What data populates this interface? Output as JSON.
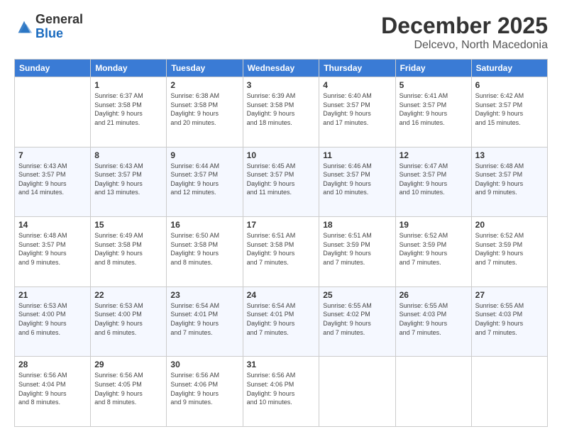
{
  "logo": {
    "general": "General",
    "blue": "Blue"
  },
  "header": {
    "month": "December 2025",
    "location": "Delcevo, North Macedonia"
  },
  "weekdays": [
    "Sunday",
    "Monday",
    "Tuesday",
    "Wednesday",
    "Thursday",
    "Friday",
    "Saturday"
  ],
  "weeks": [
    [
      {
        "day": "",
        "info": ""
      },
      {
        "day": "1",
        "info": "Sunrise: 6:37 AM\nSunset: 3:58 PM\nDaylight: 9 hours\nand 21 minutes."
      },
      {
        "day": "2",
        "info": "Sunrise: 6:38 AM\nSunset: 3:58 PM\nDaylight: 9 hours\nand 20 minutes."
      },
      {
        "day": "3",
        "info": "Sunrise: 6:39 AM\nSunset: 3:58 PM\nDaylight: 9 hours\nand 18 minutes."
      },
      {
        "day": "4",
        "info": "Sunrise: 6:40 AM\nSunset: 3:57 PM\nDaylight: 9 hours\nand 17 minutes."
      },
      {
        "day": "5",
        "info": "Sunrise: 6:41 AM\nSunset: 3:57 PM\nDaylight: 9 hours\nand 16 minutes."
      },
      {
        "day": "6",
        "info": "Sunrise: 6:42 AM\nSunset: 3:57 PM\nDaylight: 9 hours\nand 15 minutes."
      }
    ],
    [
      {
        "day": "7",
        "info": "Sunrise: 6:43 AM\nSunset: 3:57 PM\nDaylight: 9 hours\nand 14 minutes."
      },
      {
        "day": "8",
        "info": "Sunrise: 6:43 AM\nSunset: 3:57 PM\nDaylight: 9 hours\nand 13 minutes."
      },
      {
        "day": "9",
        "info": "Sunrise: 6:44 AM\nSunset: 3:57 PM\nDaylight: 9 hours\nand 12 minutes."
      },
      {
        "day": "10",
        "info": "Sunrise: 6:45 AM\nSunset: 3:57 PM\nDaylight: 9 hours\nand 11 minutes."
      },
      {
        "day": "11",
        "info": "Sunrise: 6:46 AM\nSunset: 3:57 PM\nDaylight: 9 hours\nand 10 minutes."
      },
      {
        "day": "12",
        "info": "Sunrise: 6:47 AM\nSunset: 3:57 PM\nDaylight: 9 hours\nand 10 minutes."
      },
      {
        "day": "13",
        "info": "Sunrise: 6:48 AM\nSunset: 3:57 PM\nDaylight: 9 hours\nand 9 minutes."
      }
    ],
    [
      {
        "day": "14",
        "info": "Sunrise: 6:48 AM\nSunset: 3:57 PM\nDaylight: 9 hours\nand 9 minutes."
      },
      {
        "day": "15",
        "info": "Sunrise: 6:49 AM\nSunset: 3:58 PM\nDaylight: 9 hours\nand 8 minutes."
      },
      {
        "day": "16",
        "info": "Sunrise: 6:50 AM\nSunset: 3:58 PM\nDaylight: 9 hours\nand 8 minutes."
      },
      {
        "day": "17",
        "info": "Sunrise: 6:51 AM\nSunset: 3:58 PM\nDaylight: 9 hours\nand 7 minutes."
      },
      {
        "day": "18",
        "info": "Sunrise: 6:51 AM\nSunset: 3:59 PM\nDaylight: 9 hours\nand 7 minutes."
      },
      {
        "day": "19",
        "info": "Sunrise: 6:52 AM\nSunset: 3:59 PM\nDaylight: 9 hours\nand 7 minutes."
      },
      {
        "day": "20",
        "info": "Sunrise: 6:52 AM\nSunset: 3:59 PM\nDaylight: 9 hours\nand 7 minutes."
      }
    ],
    [
      {
        "day": "21",
        "info": "Sunrise: 6:53 AM\nSunset: 4:00 PM\nDaylight: 9 hours\nand 6 minutes."
      },
      {
        "day": "22",
        "info": "Sunrise: 6:53 AM\nSunset: 4:00 PM\nDaylight: 9 hours\nand 6 minutes."
      },
      {
        "day": "23",
        "info": "Sunrise: 6:54 AM\nSunset: 4:01 PM\nDaylight: 9 hours\nand 7 minutes."
      },
      {
        "day": "24",
        "info": "Sunrise: 6:54 AM\nSunset: 4:01 PM\nDaylight: 9 hours\nand 7 minutes."
      },
      {
        "day": "25",
        "info": "Sunrise: 6:55 AM\nSunset: 4:02 PM\nDaylight: 9 hours\nand 7 minutes."
      },
      {
        "day": "26",
        "info": "Sunrise: 6:55 AM\nSunset: 4:03 PM\nDaylight: 9 hours\nand 7 minutes."
      },
      {
        "day": "27",
        "info": "Sunrise: 6:55 AM\nSunset: 4:03 PM\nDaylight: 9 hours\nand 7 minutes."
      }
    ],
    [
      {
        "day": "28",
        "info": "Sunrise: 6:56 AM\nSunset: 4:04 PM\nDaylight: 9 hours\nand 8 minutes."
      },
      {
        "day": "29",
        "info": "Sunrise: 6:56 AM\nSunset: 4:05 PM\nDaylight: 9 hours\nand 8 minutes."
      },
      {
        "day": "30",
        "info": "Sunrise: 6:56 AM\nSunset: 4:06 PM\nDaylight: 9 hours\nand 9 minutes."
      },
      {
        "day": "31",
        "info": "Sunrise: 6:56 AM\nSunset: 4:06 PM\nDaylight: 9 hours\nand 10 minutes."
      },
      {
        "day": "",
        "info": ""
      },
      {
        "day": "",
        "info": ""
      },
      {
        "day": "",
        "info": ""
      }
    ]
  ]
}
